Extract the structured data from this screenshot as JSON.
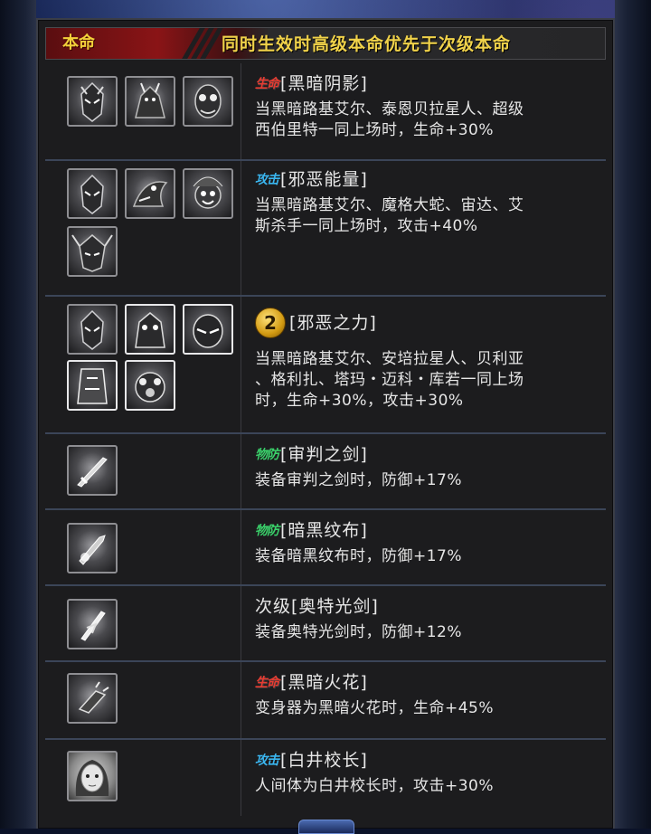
{
  "header": {
    "tag": "本命",
    "title": "同时生效时高级本命优先于次级本命"
  },
  "rows": [
    {
      "badge": "生命",
      "badge_type": "life",
      "title": "[黑暗阴影]",
      "desc": [
        "当黑暗路基艾尔、泰恩贝拉星人、超级",
        "西伯里特一同上场时，生命+30%"
      ],
      "icons": [
        "dark-lugiel-icon",
        "tyrant-monster-icon",
        "alien-icon"
      ]
    },
    {
      "badge": "攻击",
      "badge_type": "atk",
      "title": "[邪恶能量]",
      "desc": [
        "当黑暗路基艾尔、魔格大蛇、宙达、艾",
        "斯杀手一同上场时，攻击+40%"
      ],
      "icons": [
        "dark-lugiel-icon",
        "dragon-monster-icon",
        "clown-alien-icon",
        "horned-mask-icon"
      ]
    },
    {
      "badge": "2",
      "badge_type": "num",
      "title": "[邪恶之力]",
      "desc": [
        "当黑暗路基艾尔、安培拉星人、贝利亚",
        "、格利扎、塔玛・迈科・库若一同上场",
        "时，生命+30%，攻击+30%"
      ],
      "icons": [
        "dark-lugiel-icon",
        "belial-icon",
        "empera-icon",
        "grigio-icon",
        "tama-monster-icon"
      ]
    },
    {
      "badge": "物防",
      "badge_type": "def",
      "title": "[审判之剑]",
      "desc": [
        "装备审判之剑时，防御+17%"
      ],
      "icons": [
        "sword-icon"
      ]
    },
    {
      "badge": "物防",
      "badge_type": "def",
      "title": "[暗黑纹布]",
      "desc": [
        "装备暗黑纹布时，防御+17%"
      ],
      "icons": [
        "dark-blade-icon"
      ]
    },
    {
      "badge": "",
      "badge_type": "plain",
      "title": "次级[奥特光剑]",
      "desc": [
        "装备奥特光剑时，防御+12%"
      ],
      "icons": [
        "light-sword-icon"
      ]
    },
    {
      "badge": "生命",
      "badge_type": "life",
      "title": "[黑暗火花]",
      "desc": [
        "变身器为黑暗火花时，生命+45%"
      ],
      "icons": [
        "dark-spark-icon"
      ]
    },
    {
      "badge": "攻击",
      "badge_type": "atk",
      "title": "[白井校长]",
      "desc": [
        "人间体为白井校长时，攻击+30%"
      ],
      "icons": [
        "principal-portrait-icon"
      ]
    }
  ]
}
